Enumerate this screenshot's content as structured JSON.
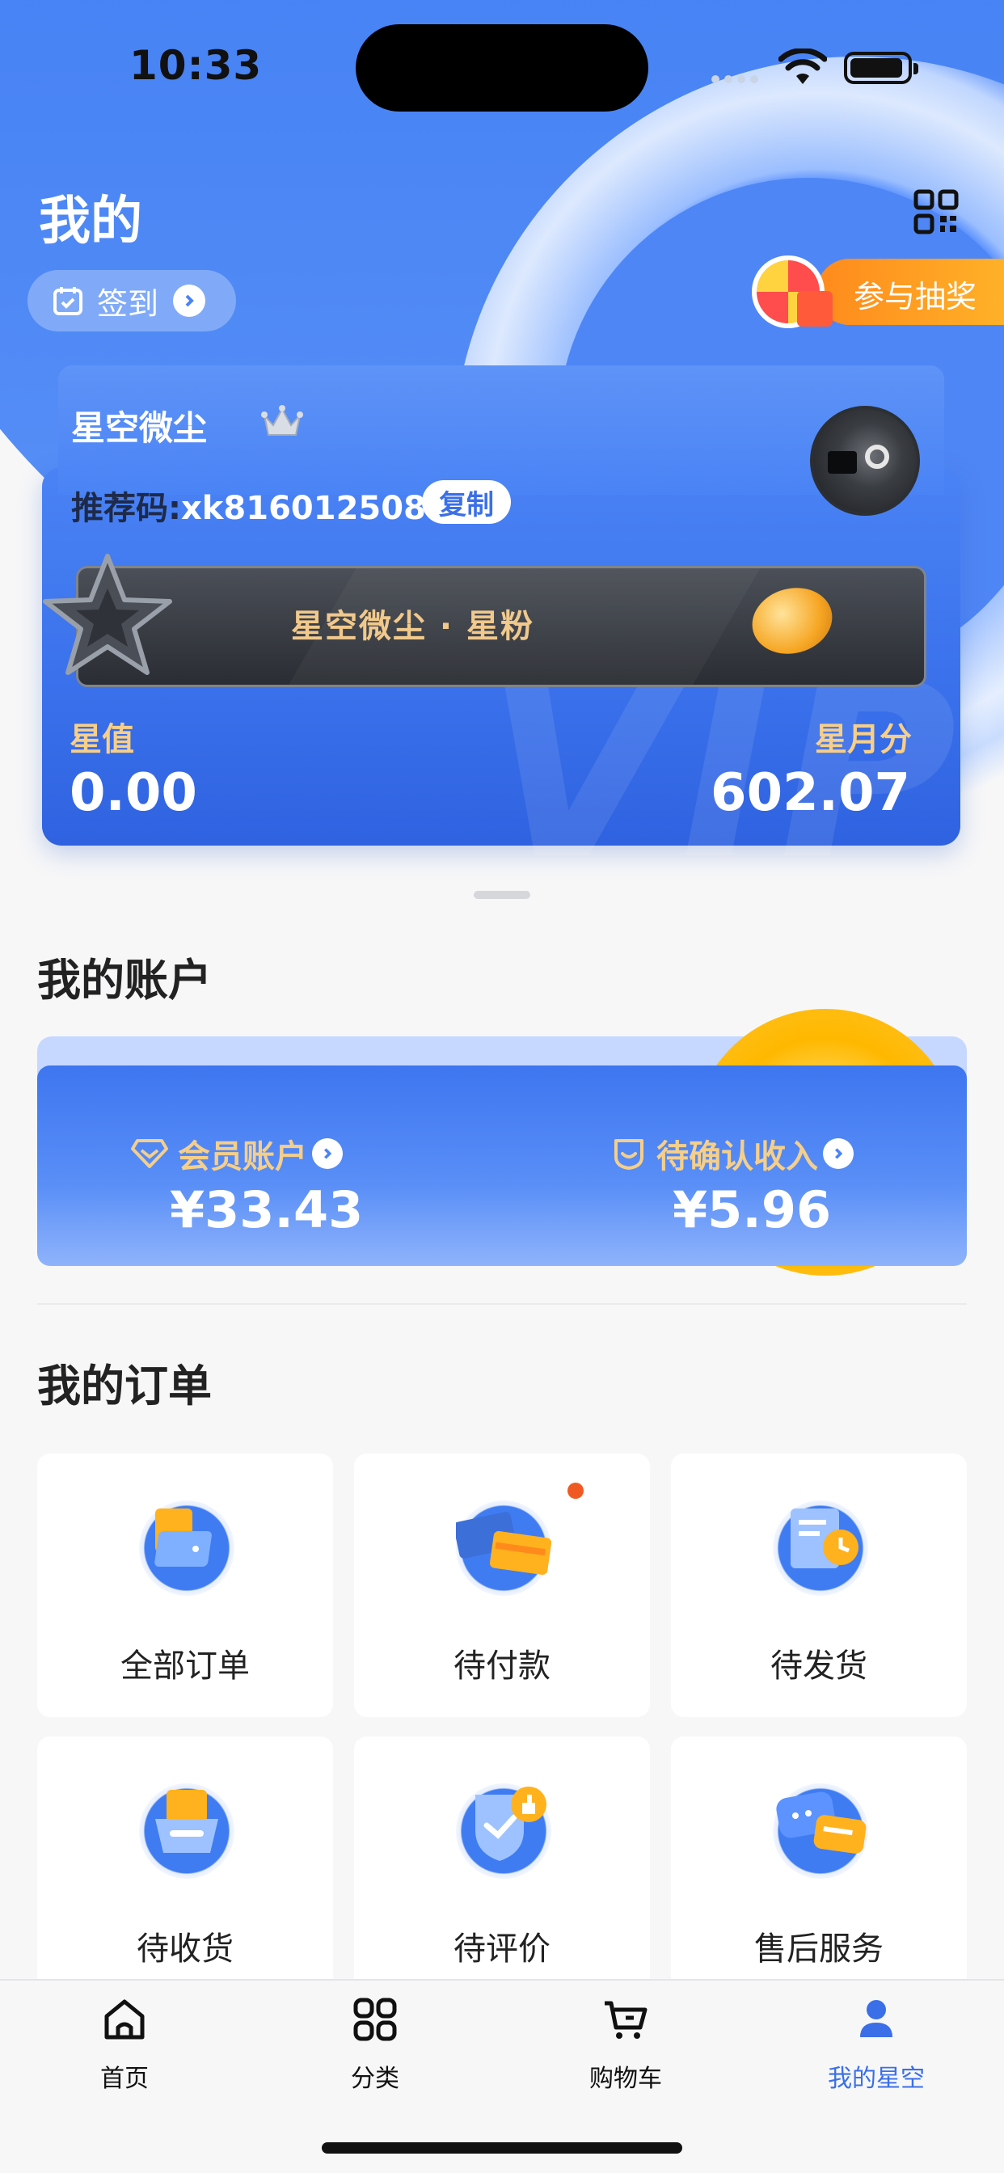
{
  "status_bar": {
    "time": "10:33"
  },
  "header": {
    "title": "我的",
    "signin_label": "签到",
    "lottery_label": "参与抽奖"
  },
  "member_card": {
    "nickname": "星空微尘",
    "referral_prefix": "推荐码:",
    "referral_code": "xk816012508",
    "copy_label": "复制",
    "fan_text": "星空微尘 · 星粉",
    "star_value_label": "星值",
    "star_value": "0.00",
    "star_month_label": "星月分",
    "star_month_value": "602.07",
    "watermark": "VIP"
  },
  "account": {
    "title": "我的账户",
    "member_account_label": "会员账户",
    "member_account_value": "¥33.43",
    "pending_income_label": "待确认收入",
    "pending_income_value": "¥5.96"
  },
  "orders": {
    "title": "我的订单",
    "items": [
      {
        "label": "全部订单",
        "icon": "all-orders-icon"
      },
      {
        "label": "待付款",
        "icon": "pending-payment-icon"
      },
      {
        "label": "待发货",
        "icon": "pending-shipment-icon"
      },
      {
        "label": "待收货",
        "icon": "pending-receipt-icon"
      },
      {
        "label": "待评价",
        "icon": "pending-review-icon"
      },
      {
        "label": "售后服务",
        "icon": "after-sales-icon"
      }
    ]
  },
  "tabbar": {
    "items": [
      {
        "label": "首页",
        "icon": "home-icon"
      },
      {
        "label": "分类",
        "icon": "category-icon"
      },
      {
        "label": "购物车",
        "icon": "cart-icon"
      },
      {
        "label": "我的星空",
        "icon": "profile-icon"
      }
    ],
    "active": "我的星空"
  },
  "colors": {
    "primary": "#3a6fe8",
    "gold": "#f7cf88",
    "badge": "#f05a22",
    "lottery": "#ff9a1f"
  }
}
